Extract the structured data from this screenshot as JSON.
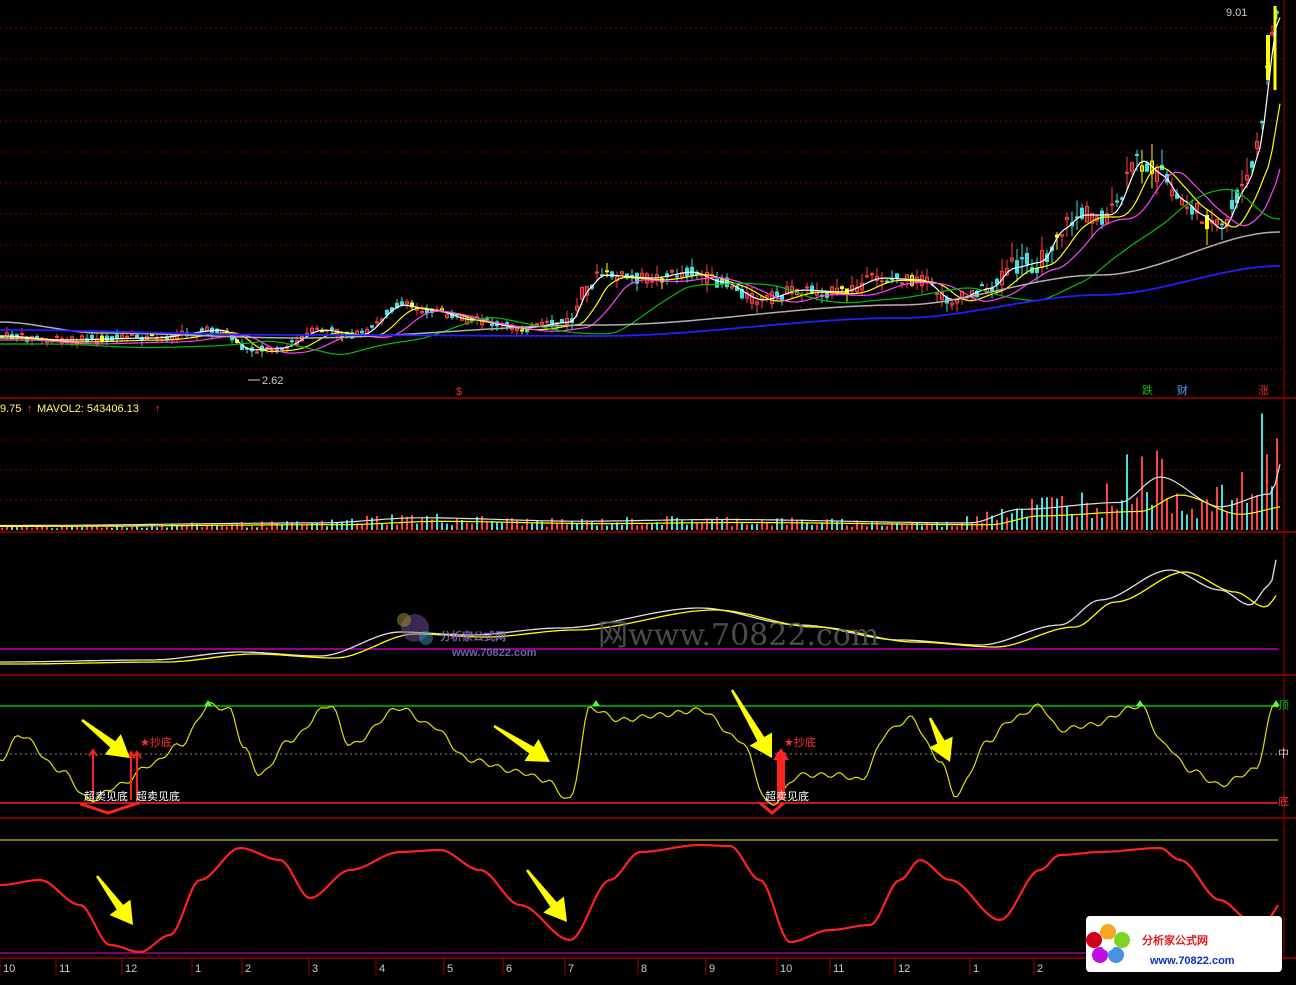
{
  "price_panel": {
    "high_label": "9.01",
    "low_label": "2.62",
    "tags": [
      {
        "text": "跌",
        "color": "#00c000"
      },
      {
        "text": "财",
        "color": "#4aa0ff"
      },
      {
        "text": "涨",
        "color": "#e03030"
      },
      {
        "text": "$",
        "color": "#e03030"
      }
    ]
  },
  "volume_panel": {
    "label_left": "9.75",
    "label_mavol": "MAVOL2: 543406.13"
  },
  "signal_panel": {
    "signals": [
      {
        "type": "oversold",
        "text": "超卖见底"
      },
      {
        "type": "oversold",
        "text": "超卖见底"
      },
      {
        "type": "oversold",
        "text": "超卖见底"
      },
      {
        "type": "buy",
        "text": "★抄底"
      },
      {
        "type": "buy",
        "text": "★抄底"
      }
    ],
    "side_labels": [
      "顶",
      "中",
      "底"
    ]
  },
  "x_axis": {
    "labels": [
      "10",
      "11",
      "12",
      "1",
      "2",
      "3",
      "4",
      "5",
      "6",
      "7",
      "8",
      "9",
      "10",
      "11",
      "12",
      "1",
      "2"
    ]
  },
  "watermark": {
    "brand": "分析家公式网",
    "url": "www.70822.com",
    "center_text": "网www.70822.com"
  },
  "colors": {
    "background": "#000000",
    "grid": "#700000",
    "up": "#ff4040",
    "down": "#40e0e0",
    "strong": "#ffff00",
    "ma_short": "#ffffff",
    "ma_mid": "#ffff00",
    "ma_pink": "#ff40ff",
    "ma_green": "#00c000",
    "ma_gray": "#b0b0b0",
    "ma_blue": "#2020ff",
    "osc_line": "#e0e000",
    "red_line": "#ff2020"
  },
  "chart_data": [
    {
      "type": "candlestick",
      "panel": "price",
      "label_high": 9.01,
      "label_low": 2.62,
      "close_profile": [
        3.05,
        3.0,
        2.95,
        2.9,
        2.95,
        3.05,
        3.1,
        3.15,
        3.1,
        2.62,
        3.0,
        3.1,
        3.3,
        3.4,
        3.6,
        3.7,
        3.55,
        3.45,
        3.4,
        3.35,
        3.3,
        3.4,
        3.5,
        4.4,
        4.5,
        4.55,
        4.6,
        4.65,
        4.5,
        4.3,
        4.2,
        4.1,
        4.25,
        4.3,
        4.35,
        4.45,
        4.3,
        4.2,
        4.1,
        4.2,
        4.9,
        5.0,
        5.2,
        6.1,
        6.6,
        7.2,
        7.35,
        6.8,
        6.2,
        5.6,
        5.45,
        5.9,
        6.6,
        9.01
      ]
    },
    {
      "type": "bar",
      "panel": "volume",
      "ma_label": "MAVOL2",
      "ma_value": 543406.13
    },
    {
      "type": "line",
      "panel": "oscillator",
      "levels": [
        "顶",
        "中",
        "底"
      ]
    },
    {
      "type": "line",
      "panel": "cycle"
    }
  ]
}
